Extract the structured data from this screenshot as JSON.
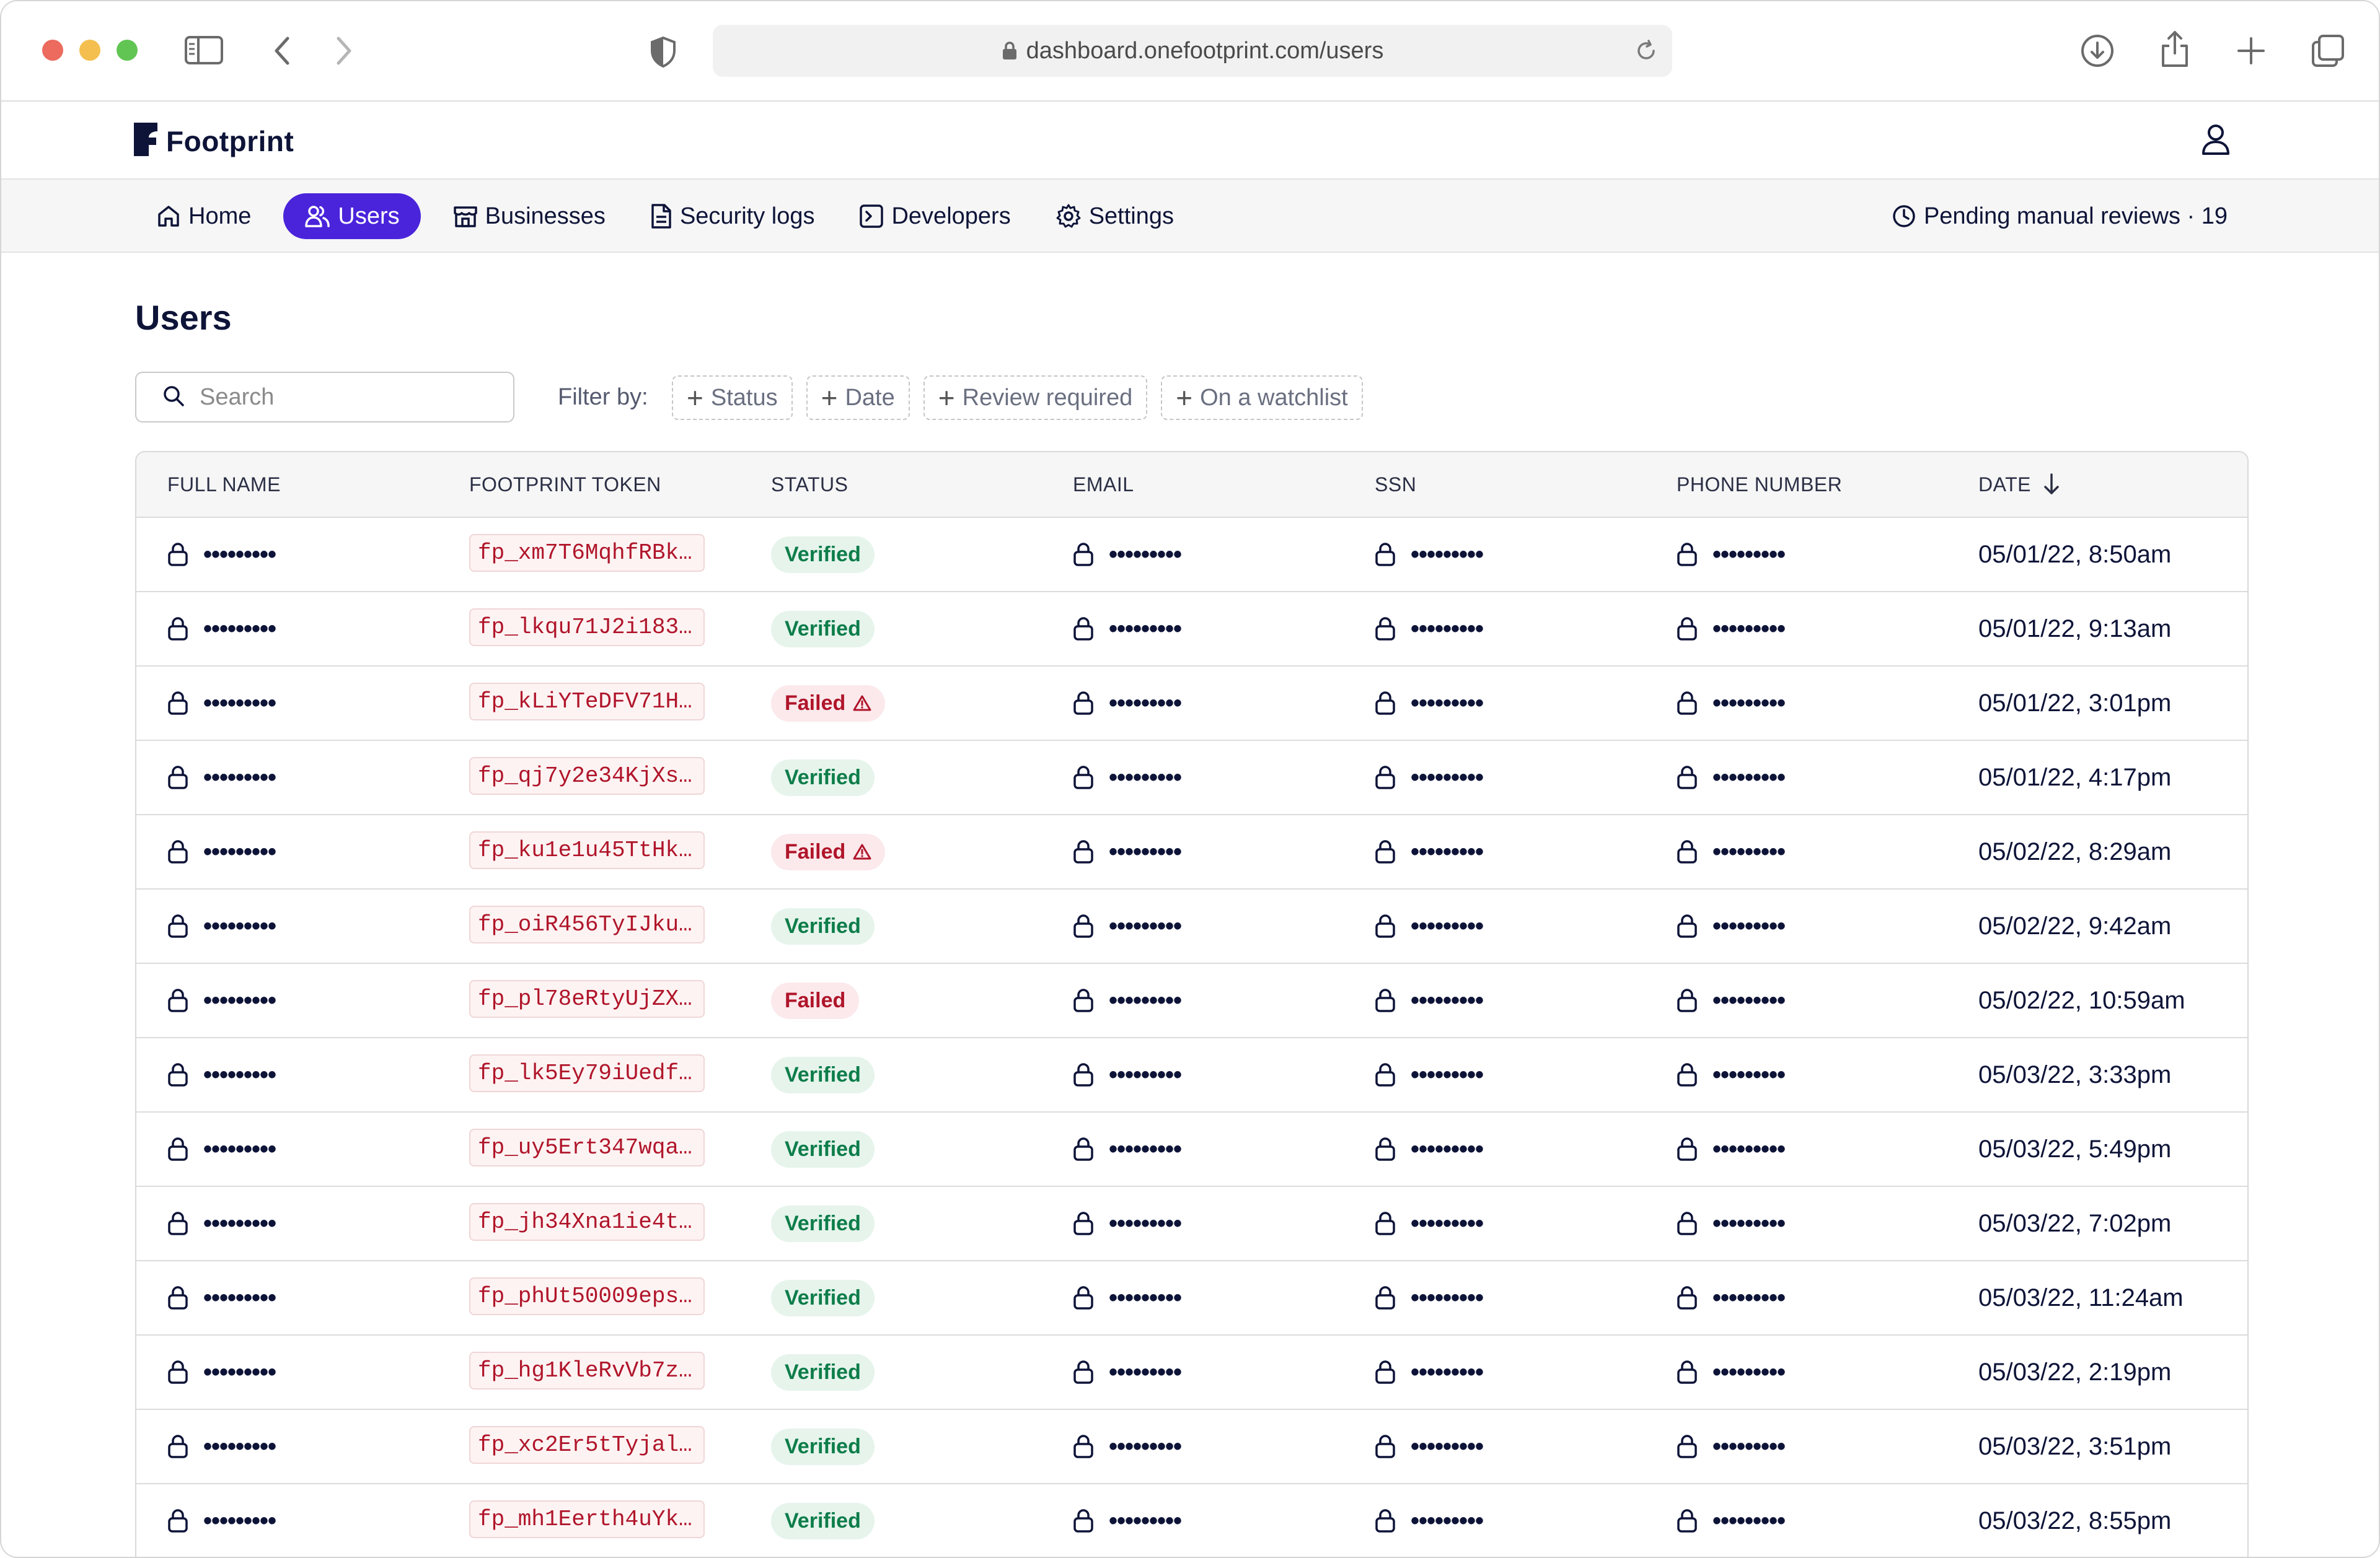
{
  "browser": {
    "url": "dashboard.onefootprint.com/users"
  },
  "app": {
    "brand": "Footprint"
  },
  "nav": {
    "items": [
      {
        "label": "Home",
        "icon": "home-icon",
        "active": false
      },
      {
        "label": "Users",
        "icon": "users-icon",
        "active": true
      },
      {
        "label": "Businesses",
        "icon": "store-icon",
        "active": false
      },
      {
        "label": "Security logs",
        "icon": "file-icon",
        "active": false
      },
      {
        "label": "Developers",
        "icon": "terminal-icon",
        "active": false
      },
      {
        "label": "Settings",
        "icon": "gear-icon",
        "active": false
      }
    ],
    "pending_reviews": "Pending manual reviews · 19"
  },
  "page": {
    "title": "Users",
    "search_placeholder": "Search",
    "filter_label": "Filter by:",
    "filters": [
      "Status",
      "Date",
      "Review required",
      "On a watchlist"
    ]
  },
  "table": {
    "columns": [
      "FULL NAME",
      "FOOTPRINT TOKEN",
      "STATUS",
      "EMAIL",
      "SSN",
      "PHONE NUMBER",
      "DATE"
    ],
    "masked": "•••••••••",
    "sort_column": "DATE",
    "sort_direction": "descending",
    "rows": [
      {
        "token": "fp_xm7T6MqhfRBk…",
        "status": "Verified",
        "warning": false,
        "date": "05/01/22, 8:50am"
      },
      {
        "token": "fp_lkqu71J2i183…",
        "status": "Verified",
        "warning": false,
        "date": "05/01/22, 9:13am"
      },
      {
        "token": "fp_kLiYTeDFV71H…",
        "status": "Failed",
        "warning": true,
        "date": "05/01/22, 3:01pm"
      },
      {
        "token": "fp_qj7y2e34KjXs…",
        "status": "Verified",
        "warning": false,
        "date": "05/01/22, 4:17pm"
      },
      {
        "token": "fp_ku1e1u45TtHk…",
        "status": "Failed",
        "warning": true,
        "date": "05/02/22, 8:29am"
      },
      {
        "token": "fp_oiR456TyIJku…",
        "status": "Verified",
        "warning": false,
        "date": "05/02/22, 9:42am"
      },
      {
        "token": "fp_pl78eRtyUjZX…",
        "status": "Failed",
        "warning": false,
        "date": "05/02/22, 10:59am"
      },
      {
        "token": "fp_lk5Ey79iUedf…",
        "status": "Verified",
        "warning": false,
        "date": "05/03/22, 3:33pm"
      },
      {
        "token": "fp_uy5Ert347wqa…",
        "status": "Verified",
        "warning": false,
        "date": "05/03/22, 5:49pm"
      },
      {
        "token": "fp_jh34Xna1ie4t…",
        "status": "Verified",
        "warning": false,
        "date": "05/03/22, 7:02pm"
      },
      {
        "token": "fp_phUt50009eps…",
        "status": "Verified",
        "warning": false,
        "date": "05/03/22, 11:24am"
      },
      {
        "token": "fp_hg1KleRvVb7z…",
        "status": "Verified",
        "warning": false,
        "date": "05/03/22, 2:19pm"
      },
      {
        "token": "fp_xc2Er5tTyjal…",
        "status": "Verified",
        "warning": false,
        "date": "05/03/22, 3:51pm"
      },
      {
        "token": "fp_mh1Eerth4uYk…",
        "status": "Verified",
        "warning": false,
        "date": "05/03/22, 8:55pm"
      }
    ]
  },
  "colors": {
    "accent": "#4a24db",
    "verified_text": "#0d7d4a",
    "verified_bg": "#e6f4ec",
    "failed_text": "#b0152a",
    "failed_bg": "#fbe9ec"
  }
}
